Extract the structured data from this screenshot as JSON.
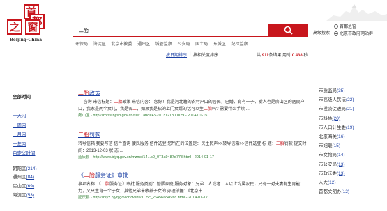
{
  "logo": {
    "chars": [
      "首",
      "都",
      "之",
      "窗"
    ],
    "subtitle": "Beijing-China"
  },
  "search": {
    "query": "二胎",
    "button_icon": "search-icon",
    "advanced_label": "高级搜索",
    "scope_options": [
      {
        "label": "首都之窗",
        "selected": false
      },
      {
        "label": "北京市政府网站群",
        "selected": true
      }
    ]
  },
  "categories": [
    "环保局",
    "海淀区",
    "北京市教委",
    "通州区",
    "城管监察",
    "公安局",
    "国土局",
    "东城区",
    "纪检监察"
  ],
  "sort": {
    "by_time": "按日期排序",
    "separator": "|",
    "by_relevance": "按相关度排序",
    "count_prefix": "共",
    "count": "911",
    "count_suffix": "条结果,用时",
    "time": "0.438",
    "time_unit": "秒"
  },
  "left_sidebar": {
    "title": "全部时间",
    "time_filters": [
      "一天内",
      "一周内",
      "一月内",
      "一年内",
      "自定义时间"
    ],
    "districts": [
      {
        "name": "朝阳区",
        "count": "(214)"
      },
      {
        "name": "通州区",
        "count": "(84)"
      },
      {
        "name": "房山区",
        "count": "(69)"
      },
      {
        "name": "海淀区",
        "count": "(53)"
      }
    ]
  },
  "results": [
    {
      "title_hl": "二胎",
      "title_rest": "政策",
      "snippet_a": "： 咨询 来信标题：",
      "snippet_hl1": "二胎",
      "snippet_b": "政策 来信内容： 您好！我是河北籍的农村户口的居民，已婚，育有一子，爱人也是房山区的居民户口，我家是两个女儿，我是名",
      "snippet_hl2": "二",
      "snippet_c": "，如果我是招的上门女婿的话可以生",
      "snippet_hl3": "二胎",
      "snippet_d": "吗? 需要什么手续 ...",
      "url": "房山区 - http://zhfss.bjfsh.gov.cn/slet...atId=FS2013121800029 - 2014-01-15"
    },
    {
      "title_hl": "二胎",
      "title_rest": "罚款",
      "snippet_a": "转导信箱 我要写信 信件查询 便民服务 信件选登 您所在的位置是：民生民声>>转导信箱>>信件选登 标 题：",
      "snippet_hl1": "二胎",
      "snippet_b": "罚款 提交时间：2013-12-03 状 态 ...",
      "url": "延庆县 - http://www.bjyq.gov.cn/mzms/14...c0_0T3a9487d778.html - 2014-01-17"
    },
    {
      "title_prefix": "《",
      "title_hl": "二胎",
      "title_rest": "服务证》审批",
      "snippet_a": "事项名称：《",
      "snippet_hl1": "二胎",
      "snippet_b": "服务证》审批 服务类别：婚姻家庭 服务对象：兄弟二人或者二人以上均属农民，只有一对夫妻有生育能力，又只生育一个子女，其他兄弟未收养子女的 办理依据：《北京市 ...",
      "url": "延庆县 - http://zsyz.bjyq.gov.cn/wsbs/T...5c_26456ac46fcc.html - 2014-01-17"
    }
  ],
  "right_sidebar": [
    {
      "name": "市质监局",
      "count": "(35)"
    },
    {
      "name": "市高级人民法",
      "count": "(22)"
    },
    {
      "name": "市投资促进局",
      "count": "(21)"
    },
    {
      "name": "市科协",
      "count": "(20)"
    },
    {
      "name": "市人口计生委",
      "count": "(19)"
    },
    {
      "name": "北京海关",
      "count": "(16)"
    },
    {
      "name": "市妇联",
      "count": "(15)"
    },
    {
      "name": "市文物局",
      "count": "(14)"
    },
    {
      "name": "市公安局",
      "count": "(13)"
    },
    {
      "name": "市政法委",
      "count": "(13)"
    },
    {
      "name": "人大",
      "count": "(12)"
    },
    {
      "name": "首都文明办",
      "count": "(12)"
    }
  ]
}
